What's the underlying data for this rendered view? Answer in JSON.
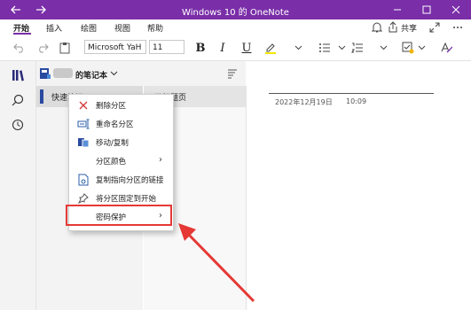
{
  "window": {
    "title": "Windows 10 的 OneNote",
    "share_label": "共享",
    "accent": "#7a2ea8"
  },
  "ribbon": {
    "tabs": [
      "开始",
      "插入",
      "绘图",
      "视图",
      "帮助"
    ],
    "active_tab": "开始",
    "font_name": "Microsoft YaH",
    "font_size": "11",
    "bold_label": "B",
    "italic_label": "I",
    "underline_label": "U"
  },
  "notebook": {
    "name_suffix": "的笔记本"
  },
  "sections": [
    {
      "label": "快速笔记",
      "selected": true
    }
  ],
  "pages": [
    {
      "label": "无标题页",
      "selected": true
    }
  ],
  "note": {
    "date": "2022年12月19日",
    "time": "10:09"
  },
  "context_menu": {
    "items": [
      {
        "label": "删除分区",
        "icon": "delete-x-icon",
        "submenu": false
      },
      {
        "label": "重命名分区",
        "icon": "rename-icon",
        "submenu": false
      },
      {
        "label": "移动/复制",
        "icon": "move-copy-icon",
        "submenu": false
      },
      {
        "label": "分区颜色",
        "icon": "",
        "submenu": true
      },
      {
        "label": "复制指向分区的链接",
        "icon": "link-icon",
        "submenu": false
      },
      {
        "label": "将分区固定到开始",
        "icon": "pin-icon",
        "submenu": false
      },
      {
        "label": "密码保护",
        "icon": "",
        "submenu": true
      }
    ],
    "highlighted_item": "密码保护",
    "highlight_color": "#e53935"
  }
}
